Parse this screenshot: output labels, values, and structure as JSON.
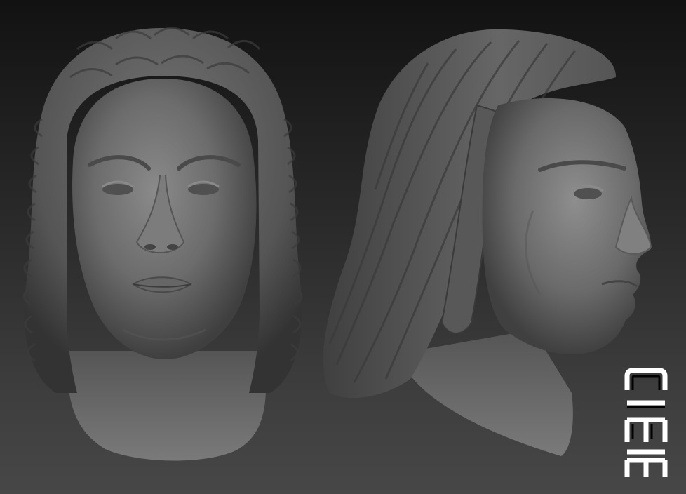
{
  "scene": {
    "subject": "sculpted-head-bust",
    "views": [
      "front-view",
      "profile-view"
    ],
    "background_color_top": "#121212",
    "background_color_bottom": "#474747",
    "material_color": "#6a6a6a"
  },
  "watermark": {
    "text": "CIEIE"
  }
}
